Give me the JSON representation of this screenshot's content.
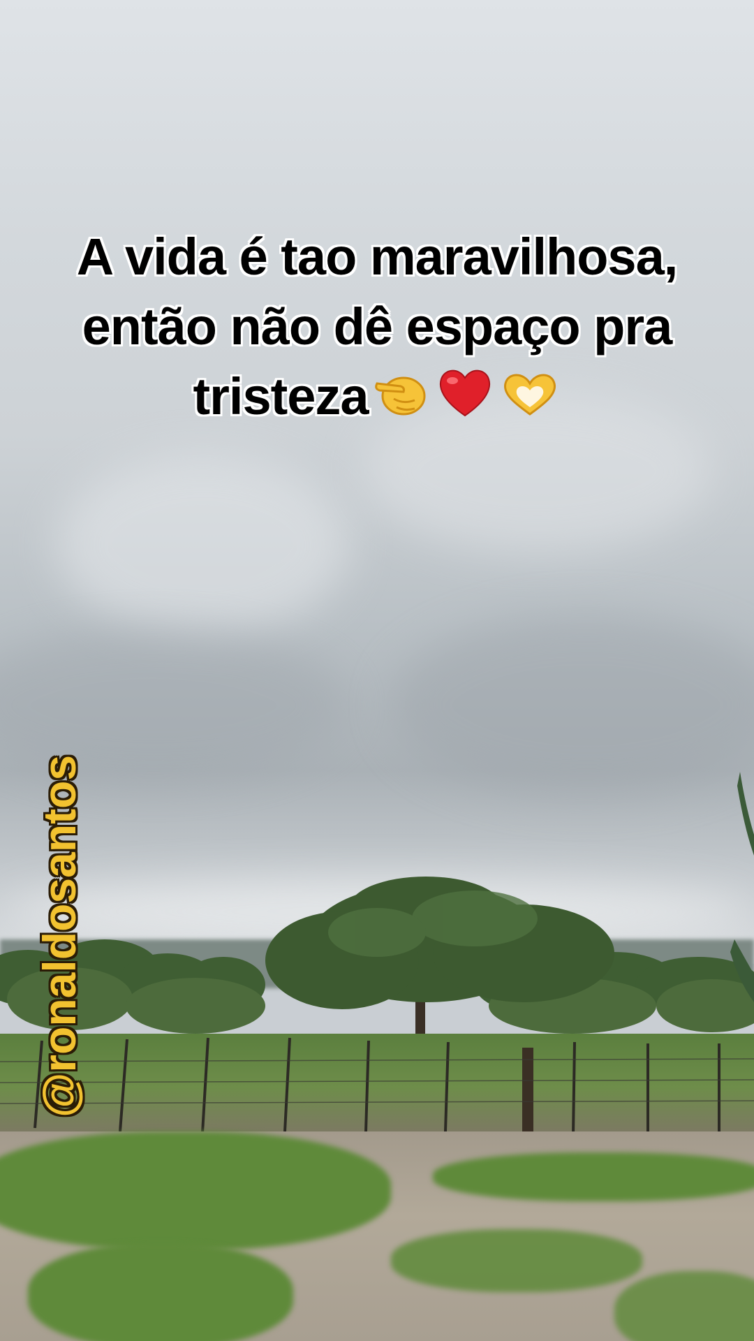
{
  "caption": {
    "line1": "A vida é tao maravilhosa,",
    "line2": "então não dê espaço pra",
    "line3": "tristeza"
  },
  "caption_emojis": [
    "pointing-finger-icon",
    "red-heart-icon",
    "heart-hands-icon"
  ],
  "watermark": {
    "handle": "@ronaldosantos"
  },
  "colors": {
    "caption_text": "#000000",
    "caption_outline": "#ffffff",
    "watermark_text": "#f2c230",
    "watermark_outline": "#2a1c06"
  }
}
